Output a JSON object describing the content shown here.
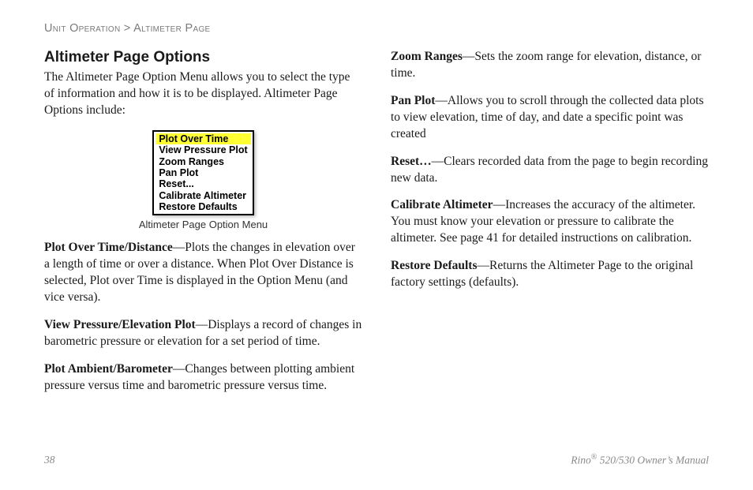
{
  "breadcrumb": {
    "section": "Unit Operation",
    "sep": " > ",
    "page": "Altimeter Page"
  },
  "left": {
    "heading": "Altimeter Page Options",
    "intro": "The Altimeter Page Option Menu allows you to select the type of information and how it is to be displayed. Altimeter Page Options include:",
    "menu_items": [
      "Plot Over Time",
      "View Pressure Plot",
      "Zoom Ranges",
      "Pan Plot",
      "Reset...",
      "Calibrate Altimeter",
      "Restore Defaults"
    ],
    "figure_caption": "Altimeter Page Option Menu",
    "defs": [
      {
        "term": "Plot Over Time/Distance",
        "desc": "—Plots the changes in elevation over a length of time or over a distance. When Plot Over Distance is selected, Plot over Time is displayed in the Option Menu (and vice versa)."
      },
      {
        "term": "View Pressure/Elevation Plot",
        "desc": "—Displays a record of changes in barometric pressure or elevation for a set period of time."
      },
      {
        "term": "Plot Ambient/Barometer",
        "desc": "—Changes between plotting ambient pressure versus time and barometric pressure versus time."
      }
    ]
  },
  "right": {
    "defs": [
      {
        "term": "Zoom Ranges",
        "desc": "—Sets the zoom range for elevation, distance, or time."
      },
      {
        "term": "Pan Plot",
        "desc": "—Allows you to scroll through the collected data plots to view elevation, time of day, and date a specific point was created"
      },
      {
        "term": "Reset…",
        "desc": "—Clears recorded data from the page to begin recording new data."
      },
      {
        "term": "Calibrate Altimeter",
        "desc": "—Increases the accuracy of the altimeter. You must know your elevation or pressure to calibrate the altimeter. See page 41 for detailed instructions on calibration."
      },
      {
        "term": "Restore Defaults",
        "desc": "—Returns the Altimeter Page to the original factory settings (defaults)."
      }
    ]
  },
  "footer": {
    "page_number": "38",
    "product_prefix": "Rino",
    "product_suffix": " 520/530 Owner’s Manual",
    "registered": "®"
  }
}
